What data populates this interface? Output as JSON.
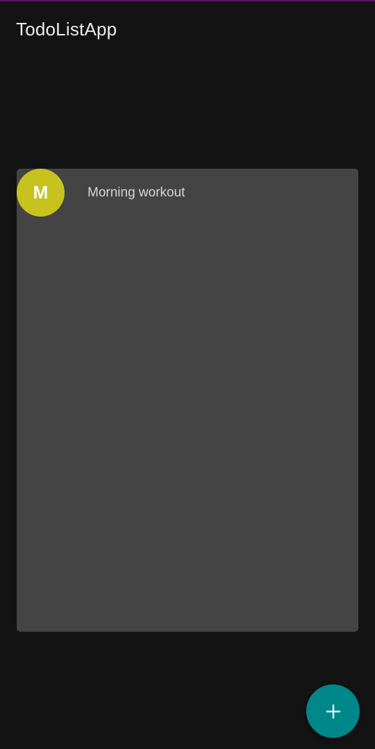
{
  "app": {
    "title": "TodoListApp"
  },
  "colors": {
    "accent_top": "#5a1466",
    "avatar": "#c7c21e",
    "fab": "#00878a"
  },
  "todos": [
    {
      "initial": "M",
      "title": "Morning workout"
    }
  ],
  "fab": {
    "icon": "plus-icon"
  }
}
